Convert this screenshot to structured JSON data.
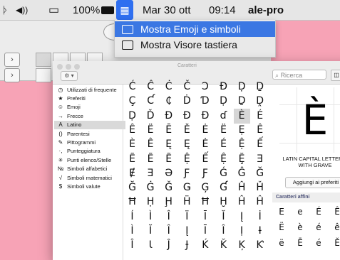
{
  "menubar": {
    "wifi_icon": "ᚦ",
    "volume_icon": "◀))",
    "airplay_icon": "▭",
    "battery": "100%",
    "input_icon": "▦",
    "date": "Mar 30 ott",
    "time": "09:14",
    "user": "ale-pro"
  },
  "menu": {
    "items": [
      {
        "label": "Mostra Emoji e simboli"
      },
      {
        "label": "Mostra Visore tastiera"
      }
    ]
  },
  "charwin": {
    "title": "Caratteri",
    "search_placeholder": "Ricerca",
    "gear": "⚙ ▾",
    "categories": [
      {
        "icon": "◷",
        "label": "Utilizzati di frequente"
      },
      {
        "icon": "★",
        "label": "Preferiti"
      },
      {
        "icon": "☺",
        "label": "Emoji"
      },
      {
        "icon": "→",
        "label": "Frecce"
      },
      {
        "icon": "A",
        "label": "Latino"
      },
      {
        "icon": "()",
        "label": "Parentesi"
      },
      {
        "icon": "✎",
        "label": "Pittogrammi"
      },
      {
        "icon": "·,",
        "label": "Punteggiatura"
      },
      {
        "icon": "✳",
        "label": "Punti elenco/Stelle"
      },
      {
        "icon": "№",
        "label": "Simboli alfabetici"
      },
      {
        "icon": "√",
        "label": "Simboli matematici"
      },
      {
        "icon": "$",
        "label": "Simboli valute"
      }
    ],
    "selected_category": "Latino",
    "grid": [
      [
        "Ć",
        "Ĉ",
        "Ċ",
        "Č",
        "Ɔ",
        "Ð",
        "Ḍ",
        "Ḏ",
        "Ḑ"
      ],
      [
        "Ç",
        "Ƈ",
        "₵",
        "Ḋ",
        "Ɗ",
        "Ḍ",
        "Ḏ",
        "Ḓ"
      ],
      [
        "Ḍ",
        "Ď",
        "Đ",
        "Đ",
        "Đ",
        "ɗ",
        "È",
        "É"
      ],
      [
        "Ê",
        "Ë",
        "Ē",
        "Ě",
        "Ė",
        "Ë",
        "Ẹ",
        "Ê"
      ],
      [
        "È",
        "Ê",
        "Ę",
        "Ę",
        "Ė",
        "É",
        "Ệ",
        "Ế"
      ],
      [
        "Ẽ",
        "Ẽ",
        "Ẽ",
        "Ệ",
        "Ế",
        "Ệ",
        "Ḝ",
        "Ǝ"
      ],
      [
        "Ɇ",
        "Ǝ",
        "Ə",
        "Ƒ",
        "Ƒ",
        "Ǵ",
        "Ĝ",
        "Ğ"
      ],
      [
        "Ğ",
        "Ġ",
        "Ǧ",
        "Ǥ",
        "Ģ",
        "Ɠ",
        "Ĥ",
        "Ȟ"
      ],
      [
        "Ħ",
        "Ḥ",
        "Ḩ",
        "Ḧ",
        "Ħ",
        "Ḫ",
        "Ĥ",
        "Ĥ"
      ],
      [
        "Í",
        "Ì",
        "Î",
        "Ï",
        "Ī",
        "Ĭ",
        "Į",
        "İ"
      ],
      [
        "Ì",
        "Ĭ",
        "Î",
        "Į",
        "Ī",
        "Î",
        "Ị",
        "Ɨ"
      ],
      [
        "Î",
        "Ɩ",
        "Ĵ",
        "Ɉ",
        "Ḱ",
        "Ǩ",
        "Ķ",
        "Ƙ"
      ]
    ],
    "selected_char": "È",
    "detail": {
      "char": "È",
      "name": "LATIN CAPITAL LETTER E WITH GRAVE",
      "fav_button": "Aggiungi ai preferiti",
      "related_title": "Caratteri affini",
      "related": [
        "E",
        "e",
        "É",
        "Ê",
        "Ë",
        "è",
        "é",
        "ê",
        "ë",
        "Ē",
        "é",
        "Ě"
      ]
    }
  }
}
